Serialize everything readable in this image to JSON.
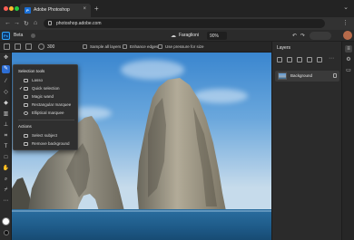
{
  "browser": {
    "tab_title": "Adobe Photoshop",
    "tab_close": "×",
    "new_tab": "+",
    "url": "photoshop.adobe.com"
  },
  "app": {
    "logo": "Ps",
    "doc_label": "Beta",
    "file_name": "Faraglioni",
    "zoom": "90%"
  },
  "options_bar": {
    "size": "300",
    "sample_all_layers": "Sample all layers",
    "enhance_edges": "Enhance edges",
    "use_pressure": "Use pressure for size"
  },
  "flyout": {
    "header_tools": "Selection tools",
    "items": [
      {
        "label": "Lasso",
        "checked": false
      },
      {
        "label": "Quick selection",
        "checked": true
      },
      {
        "label": "Magic wand",
        "checked": false
      },
      {
        "label": "Rectangular marquee",
        "checked": false
      },
      {
        "label": "Elliptical marquee",
        "checked": false
      }
    ],
    "header_actions": "Actions",
    "actions": [
      {
        "label": "Select subject"
      },
      {
        "label": "Remove background"
      }
    ]
  },
  "layers": {
    "title": "Layers",
    "layer_name": "Background"
  },
  "colors": {
    "accent": "#2e6fd6",
    "ps_blue": "#31a8ff"
  }
}
